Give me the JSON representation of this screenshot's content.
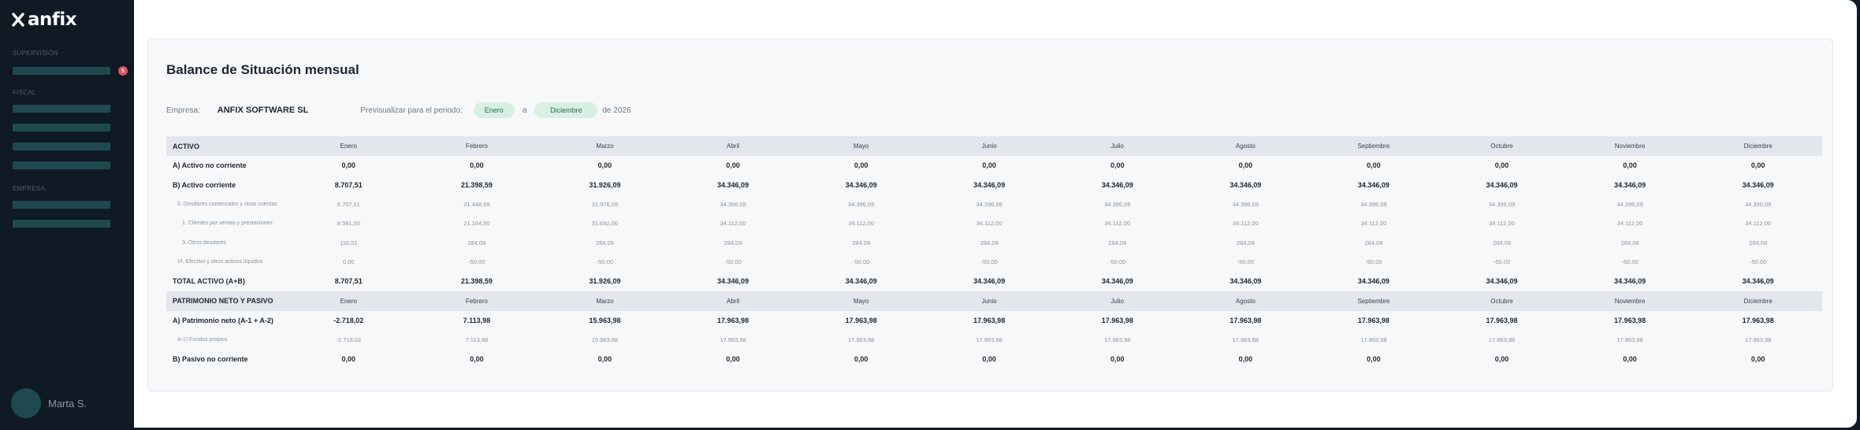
{
  "app": {
    "brand": "anfix",
    "user_name": "Marta S."
  },
  "sidebar": {
    "sections": [
      "SUPERVISIÓN",
      "FISCAL",
      "EMPRESA"
    ],
    "badge_count": "5"
  },
  "report": {
    "title": "Balance de Situación mensual",
    "company_label": "Empresa:",
    "company_name": "ANFIX SOFTWARE SL",
    "period_label": "Previsualizar para el periodo:",
    "period_from": "Enero",
    "period_separator": "a",
    "period_to": "Diciembre",
    "period_year": "de 2026"
  },
  "table": {
    "months": [
      "Enero",
      "Febrero",
      "Marzo",
      "Abril",
      "Mayo",
      "Junio",
      "Julio",
      "Agosto",
      "Septiembre",
      "Octubre",
      "Noviembre",
      "Diciembre"
    ],
    "rows": [
      {
        "kind": "header",
        "label": "ACTIVO"
      },
      {
        "kind": "bold",
        "label": "A) Activo no corriente",
        "values": [
          "0,00",
          "0,00",
          "0,00",
          "0,00",
          "0,00",
          "0,00",
          "0,00",
          "0,00",
          "0,00",
          "0,00",
          "0,00",
          "0,00"
        ]
      },
      {
        "kind": "bold",
        "label": "B) Activo corriente",
        "values": [
          "8.707,51",
          "21.398,59",
          "31.926,09",
          "34.346,09",
          "34.346,09",
          "34.346,09",
          "34.346,09",
          "34.346,09",
          "34.346,09",
          "34.346,09",
          "34.346,09",
          "34.346,09"
        ]
      },
      {
        "kind": "sub l1",
        "label": "5. Deudores comerciales y otras cuentas",
        "values": [
          "8.707,51",
          "21.448,59",
          "31.976,09",
          "34.396,09",
          "34.396,09",
          "34.396,09",
          "34.396,09",
          "34.396,09",
          "34.396,09",
          "34.396,09",
          "34.396,09",
          "34.396,09"
        ]
      },
      {
        "kind": "sub l2",
        "label": "1. Clientes por ventas y prestaciones",
        "values": [
          "8.591,00",
          "21.164,50",
          "31.692,00",
          "34.112,00",
          "34.112,00",
          "34.112,00",
          "34.112,00",
          "34.112,00",
          "34.112,00",
          "34.112,00",
          "34.112,00",
          "34.112,00"
        ]
      },
      {
        "kind": "sub l2",
        "label": "3. Otros deudores",
        "values": [
          "116,51",
          "284,09",
          "284,09",
          "284,09",
          "284,09",
          "284,09",
          "284,09",
          "284,09",
          "284,09",
          "284,09",
          "284,09",
          "284,09"
        ]
      },
      {
        "kind": "sub l1",
        "label": "VI. Efectivo y otros activos líquidos",
        "values": [
          "0,00",
          "-50,00",
          "-50,00",
          "-50,00",
          "-50,00",
          "-50,00",
          "-50,00",
          "-50,00",
          "-50,00",
          "-50,00",
          "-50,00",
          "-50,00"
        ]
      },
      {
        "kind": "bold",
        "label": "TOTAL ACTIVO (A+B)",
        "values": [
          "8.707,51",
          "21.398,59",
          "31.926,09",
          "34.346,09",
          "34.346,09",
          "34.346,09",
          "34.346,09",
          "34.346,09",
          "34.346,09",
          "34.346,09",
          "34.346,09",
          "34.346,09"
        ]
      },
      {
        "kind": "header",
        "label": "PATRIMONIO NETO Y PASIVO"
      },
      {
        "kind": "bold",
        "label": "A) Patrimonio neto (A-1 + A-2)",
        "values": [
          "-2.718,02",
          "7.113,98",
          "15.963,98",
          "17.963,98",
          "17.963,98",
          "17.963,98",
          "17.963,98",
          "17.963,98",
          "17.963,98",
          "17.963,98",
          "17.963,98",
          "17.963,98"
        ]
      },
      {
        "kind": "sub l1",
        "label": "A-1) Fondos propios",
        "values": [
          "-2.718,02",
          "7.113,98",
          "15.963,98",
          "17.963,98",
          "17.963,98",
          "17.963,98",
          "17.963,98",
          "17.963,98",
          "17.963,98",
          "17.963,98",
          "17.963,98",
          "17.963,98"
        ]
      },
      {
        "kind": "bold",
        "label": "B) Pasivo no corriente",
        "values": [
          "0,00",
          "0,00",
          "0,00",
          "0,00",
          "0,00",
          "0,00",
          "0,00",
          "0,00",
          "0,00",
          "0,00",
          "0,00",
          "0,00"
        ]
      }
    ]
  },
  "colors": {
    "sidebar_bg": "#0f1a24",
    "nav_placeholder": "#1e4a4f",
    "badge": "#e04e5a",
    "pill_bg": "#d8efe4",
    "pill_text": "#2c6e52",
    "header_row": "#e3e6ec"
  }
}
